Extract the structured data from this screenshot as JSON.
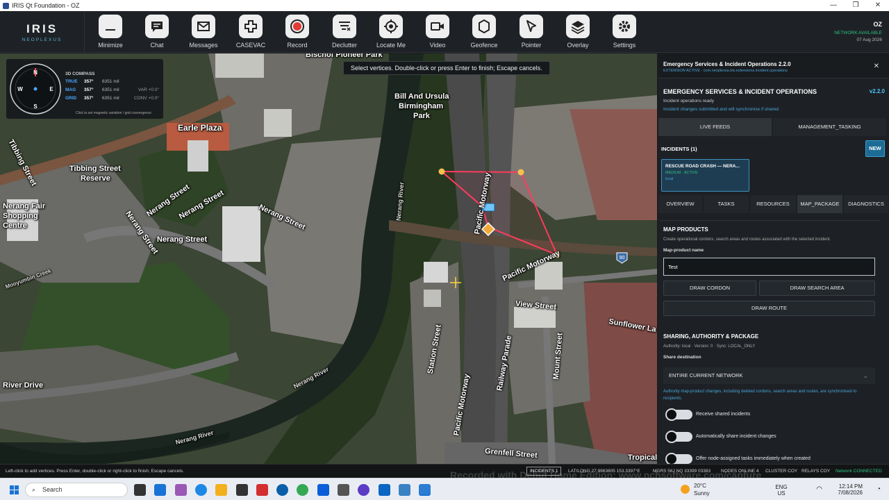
{
  "window": {
    "title": "IRIS Qt Foundation - OZ",
    "controls": [
      "—",
      "❐",
      "✕"
    ]
  },
  "logo": {
    "word": "IRIS",
    "sub": "NEOPLEXUS"
  },
  "toolbar": {
    "buttons": [
      {
        "label": "Minimize",
        "icon": "minimize-icon"
      },
      {
        "label": "Chat",
        "icon": "chat-icon"
      },
      {
        "label": "Messages",
        "icon": "mail-icon"
      },
      {
        "label": "CASEVAC",
        "icon": "medical-cross-icon"
      },
      {
        "label": "Record",
        "icon": "record-icon"
      },
      {
        "label": "Declutter",
        "icon": "declutter-icon"
      },
      {
        "label": "Locate Me",
        "icon": "crosshair-icon"
      },
      {
        "label": "Video",
        "icon": "video-icon"
      },
      {
        "label": "Geofence",
        "icon": "geofence-icon"
      },
      {
        "label": "Pointer",
        "icon": "pointer-icon"
      },
      {
        "label": "Overlay",
        "icon": "layers-icon"
      },
      {
        "label": "Settings",
        "icon": "gear-icon"
      }
    ]
  },
  "session": {
    "user": "OZ",
    "network": "NETWORK AVAILABLE",
    "date": "07 Aug 2026"
  },
  "map": {
    "hint": "Select vertices. Double-click or press Enter to finish; Escape cancels.",
    "labels": [
      "Bischof Pioneer Park",
      "Bill And Ursula",
      "Birmingham",
      "Park",
      "Earle Plaza",
      "Tibbing Street",
      "Tibbing Street",
      "Reserve",
      "Nerang Street",
      "Nerang Street",
      "Nerang Street",
      "Nerang Street",
      "Nerang River",
      "Nerang River",
      "Nerang River",
      "Pacific Motorway",
      "Pacific Motorway",
      "Pacific Motorway",
      "View Street",
      "Station Street",
      "Railway Parade",
      "Mount Street",
      "Sunflower La",
      "Grenfell Street",
      "Mooyumbin Creek",
      "Nerang Fair",
      "Shopping",
      "Centre",
      "River Drive",
      "Tropical",
      "Nerang Street"
    ],
    "shield": "90"
  },
  "compass": {
    "title": "3D COMPASS",
    "cardinals": [
      "N",
      "E",
      "S",
      "W"
    ],
    "rows": [
      {
        "key": "TRUE",
        "val": "357°",
        "mils": "6351 mil",
        "extra": ""
      },
      {
        "key": "MAG",
        "val": "357°",
        "mils": "6351 mil",
        "extra": "VAR +0.0°"
      },
      {
        "key": "GRID",
        "val": "357°",
        "mils": "6351 mil",
        "extra": "CONV +0.0°"
      }
    ],
    "hint": "Click to set magnetic variation / grid convergence"
  },
  "panel": {
    "header_title": "Emergency Services & Incident Operations 2.2.0",
    "header_sub": "EXTENSION ACTIVE · com.neoplexus.iris.extensions.incident.operations",
    "close": "✕",
    "ext_title": "EMERGENCY SERVICES & INCIDENT OPERATIONS",
    "ext_version": "v2.2.0",
    "ext_status": "Incident operations ready",
    "ext_sync": "Incident changes submitted and will synchronise if shared.",
    "feed_tabs": [
      "LIVE FEEDS",
      "MANAGEMENT_TASKING"
    ],
    "incidents_title": "INCIDENTS (1)",
    "new_label": "NEW",
    "incident": {
      "title": "RESCUE ROAD CRASH — NERA...",
      "status": "MEDIUM · ACTIVE",
      "scope": "local"
    },
    "sub_tabs": [
      "OVERVIEW",
      "TASKS",
      "RESOURCES",
      "MAP_PACKAGE",
      "DIAGNOSTICS"
    ],
    "map_products": {
      "title": "MAP PRODUCTS",
      "desc": "Create operational cordons, search areas and routes associated with the selected incident.",
      "name_label": "Map-product name",
      "name_value": "Test",
      "draw_cordon": "DRAW CORDON",
      "draw_search": "DRAW SEARCH AREA",
      "draw_route": "DRAW ROUTE"
    },
    "sharing": {
      "title": "SHARING, AUTHORITY & PACKAGE",
      "authority": "Authority: local · Version: 0 · Sync: LOCAL_ONLY",
      "dest_label": "Share destination",
      "dest_value": "ENTIRE CURRENT NETWORK",
      "note": "Authority map-product changes, including deleted cordons, search areas and routes, are synchronised to recipients.",
      "toggles": [
        "Receive shared incidents",
        "Automatically share incident changes",
        "Offer node-assigned tasks immediately when created"
      ]
    }
  },
  "statusbar": {
    "hint": "Left-click to add vertices. Press Enter, double-click or right-click to finish; Escape cancels.",
    "incidents": "INCIDENTS 1",
    "latlong": "LAT/LONG  27.9963805 153.3397°E",
    "mgrs": "MGRS  56J NQ 33399 03383",
    "nodes": "NODES ONLINE  4",
    "cluster": "CLUSTER  COY",
    "relays": "RELAYS  COY",
    "network": "Network CONNECTED"
  },
  "watermark": "Recorded with Debut Home Edition: www.nchsoftware.com/capture",
  "taskbar": {
    "search": "Search",
    "weather_temp": "20°C",
    "weather_desc": "Sunny",
    "lang": "ENG",
    "region": "US",
    "time": "12:14 PM",
    "date": "7/08/2026"
  },
  "colors": {
    "accent": "#4aa3d8",
    "ok": "#2ec27e",
    "polygon": "#ff3b5c",
    "vertex": "#f2c14e"
  }
}
